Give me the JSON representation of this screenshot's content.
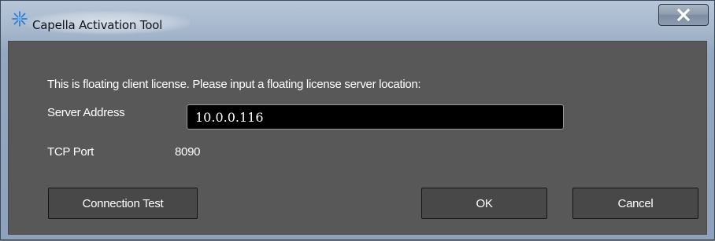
{
  "window": {
    "title": "Capella Activation Tool",
    "app_icon": "capella-snowflake-icon",
    "close_icon": "close-icon"
  },
  "form": {
    "intro_text": "This is floating client license.  Please input a floating license server location:",
    "server_address_label": "Server Address",
    "server_address_value": "10.0.0.116",
    "tcp_port_label": "TCP Port",
    "tcp_port_value": "8090"
  },
  "buttons": {
    "connection_test": "Connection Test",
    "ok": "OK",
    "cancel": "Cancel"
  },
  "colors": {
    "dialog_background": "#585858",
    "input_background": "#000000",
    "button_background": "#484848",
    "text": "#ffffff"
  }
}
